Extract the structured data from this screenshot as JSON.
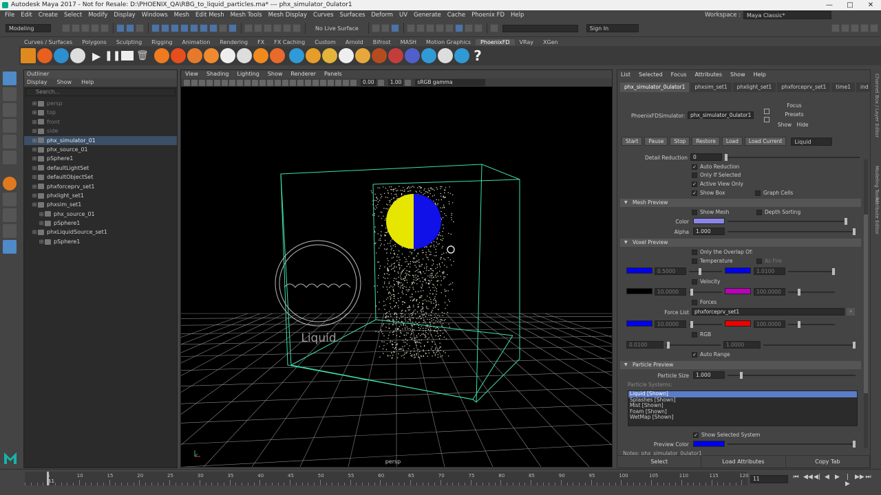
{
  "window": {
    "title": "Autodesk Maya 2017 - Not for Resale: D:\\PHOENIX_QA\\RBG_to_liquid_particles.ma*  ---  phx_simulator_0ulator1",
    "controls": [
      "—",
      "□",
      "✕"
    ]
  },
  "menubar": {
    "items": [
      "File",
      "Edit",
      "Create",
      "Select",
      "Modify",
      "Display",
      "Windows",
      "Mesh",
      "Edit Mesh",
      "Mesh Tools",
      "Mesh Display",
      "Curves",
      "Surfaces",
      "Deform",
      "UV",
      "Generate",
      "Cache",
      "Phoenix FD",
      "Help"
    ],
    "workspace_label": "Workspace :",
    "workspace_value": "Maya Classic*"
  },
  "statusline": {
    "mode": "Modeling",
    "live_surface": "No Live Surface",
    "sign_in": "Sign In"
  },
  "shelf": {
    "tabs": [
      "Curves / Surfaces",
      "Polygons",
      "Sculpting",
      "Rigging",
      "Animation",
      "Rendering",
      "FX",
      "FX Caching",
      "Custom",
      "Arnold",
      "Bifrost",
      "MASH",
      "Motion Graphics",
      "PhoenixFD",
      "VRay",
      "XGen"
    ],
    "active_tab": "PhoenixFD"
  },
  "outliner": {
    "title": "Outliner",
    "menu": [
      "Display",
      "Show",
      "Help"
    ],
    "search_placeholder": "Search...",
    "items": [
      {
        "label": "persp",
        "dim": true,
        "indent": 0
      },
      {
        "label": "top",
        "dim": true,
        "indent": 0
      },
      {
        "label": "front",
        "dim": true,
        "indent": 0
      },
      {
        "label": "side",
        "dim": true,
        "indent": 0
      },
      {
        "label": "phx_simulator_01",
        "dim": false,
        "indent": 0,
        "selected": true
      },
      {
        "label": "phx_source_01",
        "dim": false,
        "indent": 0
      },
      {
        "label": "pSphere1",
        "dim": false,
        "indent": 0
      },
      {
        "label": "defaultLightSet",
        "dim": false,
        "indent": 0
      },
      {
        "label": "defaultObjectSet",
        "dim": false,
        "indent": 0
      },
      {
        "label": "phxforceprv_set1",
        "dim": false,
        "indent": 0
      },
      {
        "label": "phxlight_set1",
        "dim": false,
        "indent": 0
      },
      {
        "label": "phxsim_set1",
        "dim": false,
        "indent": 0
      },
      {
        "label": "phx_source_01",
        "dim": false,
        "indent": 1
      },
      {
        "label": "pSphere1",
        "dim": false,
        "indent": 1
      },
      {
        "label": "phxLiquidSource_set1",
        "dim": false,
        "indent": 0
      },
      {
        "label": "pSphere1",
        "dim": false,
        "indent": 1
      }
    ]
  },
  "viewport": {
    "menu": [
      "View",
      "Shading",
      "Lighting",
      "Show",
      "Renderer",
      "Panels"
    ],
    "exposure": "0.00",
    "gamma": "1.00",
    "colorspace": "sRGB gamma",
    "camera": "persp",
    "liquid_icon_label": "Liquid"
  },
  "attr": {
    "menu": [
      "List",
      "Selected",
      "Focus",
      "Attributes",
      "Show",
      "Help"
    ],
    "tabs": [
      "phx_simulator_0ulator1",
      "phxsim_set1",
      "phxlight_set1",
      "phxforceprv_set1",
      "time1",
      "ind"
    ],
    "node_label": "PhoenixFDSimulator:",
    "node_value": "phx_simulator_0ulator1",
    "focus": "Focus",
    "presets": "Presets",
    "show": "Show",
    "hide": "Hide",
    "sim_buttons": [
      "Start",
      "Pause",
      "Stop",
      "Restore",
      "Load",
      "Load Current"
    ],
    "sim_type": "Liquid",
    "detail_reduction_label": "Detail Reduction",
    "detail_reduction_value": "0",
    "auto_reduction": "Auto Reduction",
    "only_if_selected": "Only If Selected",
    "active_view_only": "Active View Only",
    "show_box": "Show Box",
    "graph_cells": "Graph Cells",
    "mesh_preview": "Mesh Preview",
    "show_mesh": "Show Mesh",
    "depth_sorting": "Depth Sorting",
    "color_label": "Color",
    "alpha_label": "Alpha",
    "alpha_value": "1.000",
    "voxel_preview": "Voxel Preview",
    "only_overlap": "Only the Overlap Of:",
    "temperature": "Temperature",
    "as_fire": "As Fire",
    "temp_low": "0.5000",
    "temp_high": "1.0100",
    "velocity": "Velocity",
    "vel_low": "10.0000",
    "vel_high": "100.0000",
    "forces": "Forces",
    "force_list_label": "Force List",
    "force_list_value": "phxforceprv_set1",
    "force_low": "10.0000",
    "force_high": "100.0000",
    "rgb": "RGB",
    "rgb_low": "0.0100",
    "rgb_high": "1.0000",
    "auto_range": "Auto Range",
    "particle_preview": "Particle Preview",
    "particle_size_label": "Particle Size",
    "particle_size_value": "1.000",
    "particle_systems_label": "Particle Systems:",
    "particle_systems": [
      "Liquid [Shown]",
      "Splashes [Shown]",
      "Mist [Shown]",
      "Foam [Shown]",
      "WetMap [Shown]"
    ],
    "show_selected_system": "Show Selected System",
    "preview_color_label": "Preview Color",
    "notes": "Notes:  phx_simulator_0ulator1",
    "bottom_buttons": [
      "Select",
      "Load Attributes",
      "Copy Tab"
    ],
    "colors": {
      "mesh_color": "#8a86e8",
      "temp_low": "#0000ee",
      "temp_high": "#0000ee",
      "vel_low": "#000000",
      "vel_high": "#bb00bb",
      "force_low": "#0000ee",
      "force_high": "#ee0000",
      "preview_color": "#0000ee"
    }
  },
  "right_sidebar": [
    "Channel Box / Layer Editor",
    "Modeling Toolkit",
    "Attribute Editor"
  ],
  "timeline": {
    "ticks": [
      "5",
      "10",
      "15",
      "20",
      "25",
      "30",
      "35",
      "40",
      "45",
      "50",
      "55",
      "60",
      "65",
      "70",
      "75",
      "80",
      "85",
      "90",
      "95",
      "100",
      "105",
      "110",
      "115",
      "120"
    ],
    "current_frame": "11",
    "marker": "11"
  }
}
